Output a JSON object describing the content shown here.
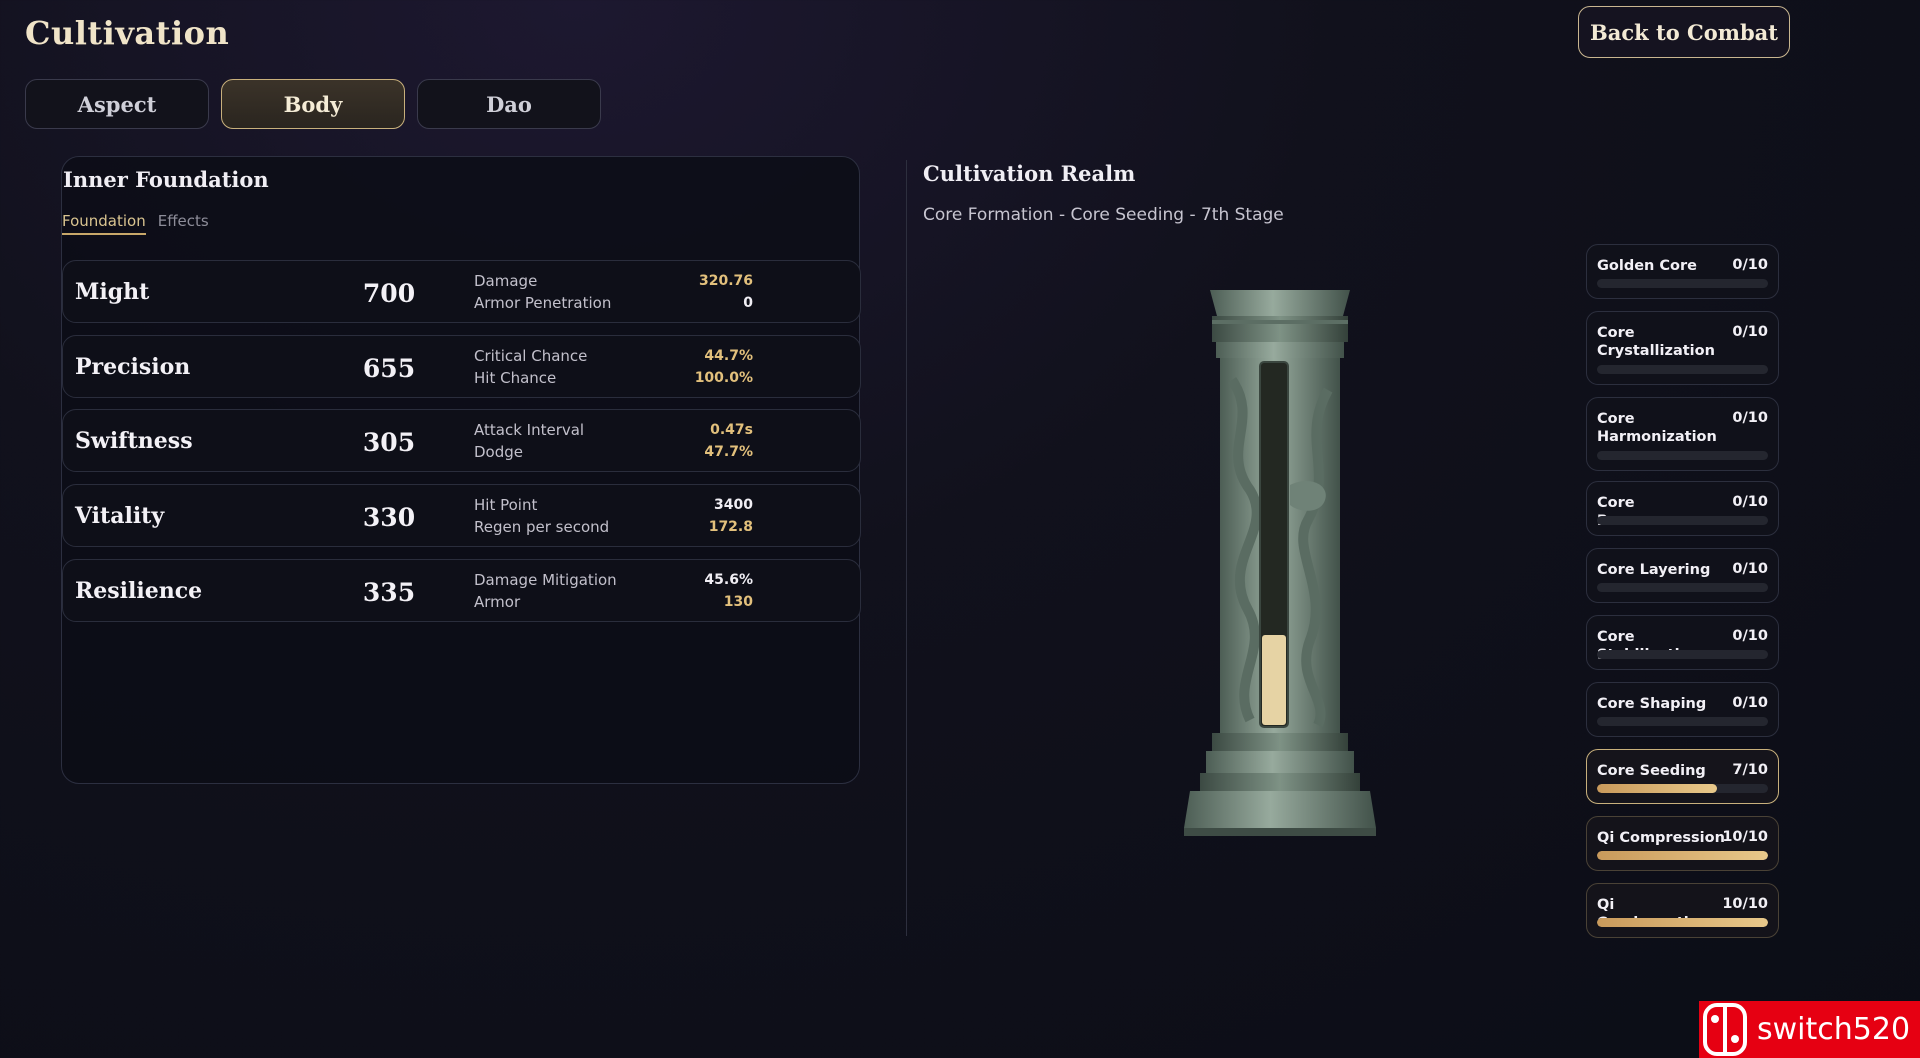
{
  "title": "Cultivation",
  "back_button": "Back to Combat",
  "tabs": [
    {
      "label": "Aspect",
      "active": false
    },
    {
      "label": "Body",
      "active": true
    },
    {
      "label": "Dao",
      "active": false
    }
  ],
  "foundation": {
    "title": "Inner Foundation",
    "subtabs": [
      {
        "label": "Foundation",
        "active": true
      },
      {
        "label": "Effects",
        "active": false
      }
    ],
    "stats": [
      {
        "name": "Might",
        "value": "700",
        "details": [
          {
            "label": "Damage",
            "value": "320.76",
            "highlight": true
          },
          {
            "label": "Armor Penetration",
            "value": "0",
            "highlight": false
          }
        ]
      },
      {
        "name": "Precision",
        "value": "655",
        "details": [
          {
            "label": "Critical Chance",
            "value": "44.7%",
            "highlight": true
          },
          {
            "label": "Hit Chance",
            "value": "100.0%",
            "highlight": true
          }
        ]
      },
      {
        "name": "Swiftness",
        "value": "305",
        "details": [
          {
            "label": "Attack Interval",
            "value": "0.47s",
            "highlight": true
          },
          {
            "label": "Dodge",
            "value": "47.7%",
            "highlight": true
          }
        ]
      },
      {
        "name": "Vitality",
        "value": "330",
        "details": [
          {
            "label": "Hit Point",
            "value": "3400",
            "highlight": false
          },
          {
            "label": "Regen per second",
            "value": "172.8",
            "highlight": true
          }
        ]
      },
      {
        "name": "Resilience",
        "value": "335",
        "details": [
          {
            "label": "Damage Mitigation",
            "value": "45.6%",
            "highlight": false
          },
          {
            "label": "Armor",
            "value": "130",
            "highlight": true
          }
        ]
      }
    ]
  },
  "realm": {
    "title": "Cultivation Realm",
    "subtitle": "Core Formation - Core Seeding - 7th Stage",
    "pillar_fill_fraction": 0.2,
    "stages": [
      {
        "name": "Golden Core",
        "count": "0/10",
        "progress": 0.0,
        "state": "locked"
      },
      {
        "name": "Core Crystallization",
        "count": "0/10",
        "progress": 0.0,
        "state": "locked"
      },
      {
        "name": "Core Harmonization",
        "count": "0/10",
        "progress": 0.0,
        "state": "locked"
      },
      {
        "name": "Core Resonance",
        "count": "0/10",
        "progress": 0.0,
        "state": "locked"
      },
      {
        "name": "Core Layering",
        "count": "0/10",
        "progress": 0.0,
        "state": "locked"
      },
      {
        "name": "Core Stabilization",
        "count": "0/10",
        "progress": 0.0,
        "state": "locked"
      },
      {
        "name": "Core Shaping",
        "count": "0/10",
        "progress": 0.0,
        "state": "locked"
      },
      {
        "name": "Core Seeding",
        "count": "7/10",
        "progress": 0.7,
        "state": "current"
      },
      {
        "name": "Qi Compression",
        "count": "10/10",
        "progress": 1.0,
        "state": "done"
      },
      {
        "name": "Qi Condensation",
        "count": "10/10",
        "progress": 1.0,
        "state": "done"
      }
    ]
  },
  "watermark": "switch520",
  "colors": {
    "accent_gold": "#e2c07c",
    "bar_fill": "#d6ae6e",
    "watermark_red": "#e60012"
  }
}
